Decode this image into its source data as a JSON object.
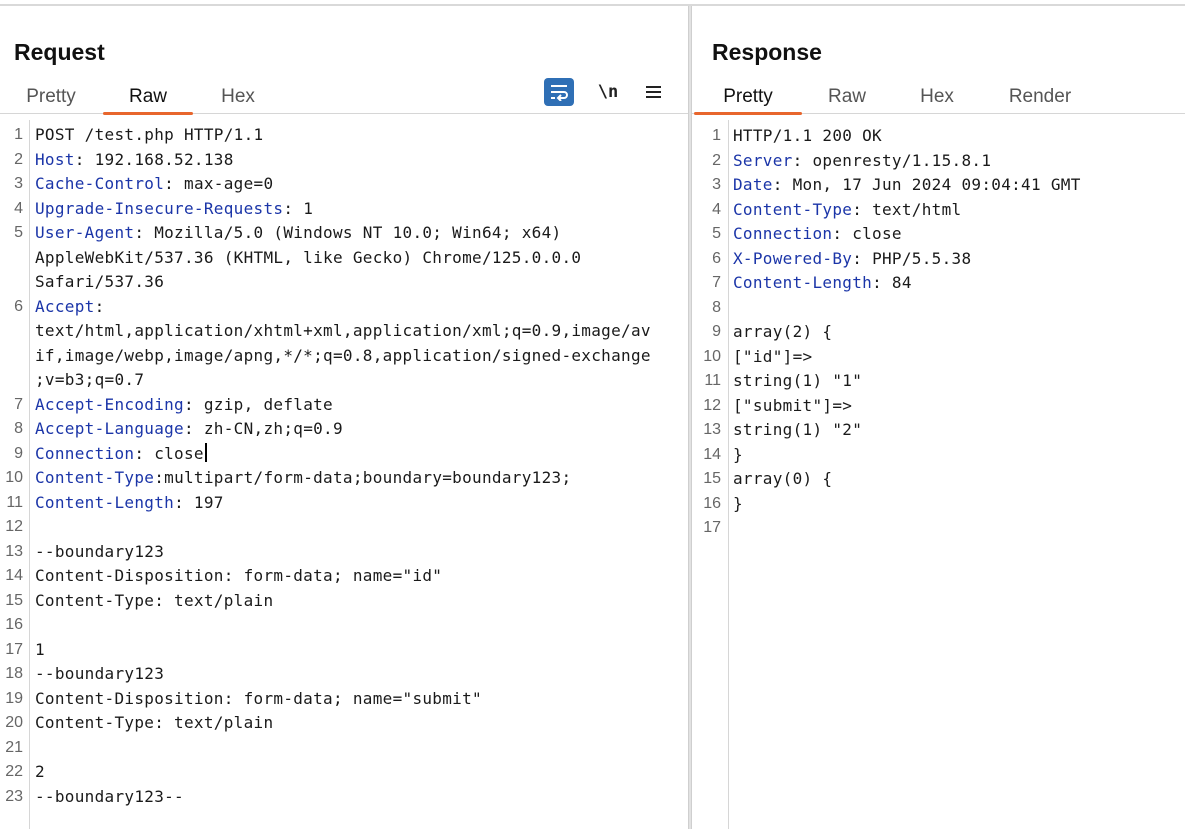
{
  "request": {
    "title": "Request",
    "tabs": [
      "Pretty",
      "Raw",
      "Hex"
    ],
    "active_tab": "Raw",
    "toolbar": {
      "newline_label": "\\n"
    },
    "lines": [
      {
        "n": "1",
        "key": "",
        "val": "POST /test.php HTTP/1.1"
      },
      {
        "n": "2",
        "key": "Host",
        "val": ": 192.168.52.138"
      },
      {
        "n": "3",
        "key": "Cache-Control",
        "val": ": max-age=0"
      },
      {
        "n": "4",
        "key": "Upgrade-Insecure-Requests",
        "val": ": 1"
      },
      {
        "n": "5",
        "key": "User-Agent",
        "val": ": Mozilla/5.0 (Windows NT 10.0; Win64; x64)"
      },
      {
        "n": "",
        "key": "",
        "val": "AppleWebKit/537.36 (KHTML, like Gecko) Chrome/125.0.0.0"
      },
      {
        "n": "",
        "key": "",
        "val": "Safari/537.36"
      },
      {
        "n": "6",
        "key": "Accept",
        "val": ":"
      },
      {
        "n": "",
        "key": "",
        "val": "text/html,application/xhtml+xml,application/xml;q=0.9,image/av"
      },
      {
        "n": "",
        "key": "",
        "val": "if,image/webp,image/apng,*/*;q=0.8,application/signed-exchange"
      },
      {
        "n": "",
        "key": "",
        "val": ";v=b3;q=0.7"
      },
      {
        "n": "7",
        "key": "Accept-Encoding",
        "val": ": gzip, deflate"
      },
      {
        "n": "8",
        "key": "Accept-Language",
        "val": ": zh-CN,zh;q=0.9"
      },
      {
        "n": "9",
        "key": "Connection",
        "val": ": close",
        "cursor": true,
        "highlight": true
      },
      {
        "n": "10",
        "key": "Content-Type",
        "val": ":multipart/form-data;boundary=boundary123;"
      },
      {
        "n": "11",
        "key": "Content-Length",
        "val": ": 197"
      },
      {
        "n": "12",
        "key": "",
        "val": ""
      },
      {
        "n": "13",
        "key": "",
        "val": "--boundary123"
      },
      {
        "n": "14",
        "key": "",
        "val": "Content-Disposition: form-data; name=\"id\""
      },
      {
        "n": "15",
        "key": "",
        "val": "Content-Type: text/plain"
      },
      {
        "n": "16",
        "key": "",
        "val": ""
      },
      {
        "n": "17",
        "key": "",
        "val": "1"
      },
      {
        "n": "18",
        "key": "",
        "val": "--boundary123"
      },
      {
        "n": "19",
        "key": "",
        "val": "Content-Disposition: form-data; name=\"submit\""
      },
      {
        "n": "20",
        "key": "",
        "val": "Content-Type: text/plain"
      },
      {
        "n": "21",
        "key": "",
        "val": ""
      },
      {
        "n": "22",
        "key": "",
        "val": "2"
      },
      {
        "n": "23",
        "key": "",
        "val": "--boundary123--"
      }
    ]
  },
  "response": {
    "title": "Response",
    "tabs": [
      "Pretty",
      "Raw",
      "Hex",
      "Render"
    ],
    "active_tab": "Pretty",
    "lines": [
      {
        "n": "1",
        "key": "",
        "val": "HTTP/1.1 200 OK",
        "highlight": true
      },
      {
        "n": "2",
        "key": "Server",
        "val": ": openresty/1.15.8.1"
      },
      {
        "n": "3",
        "key": "Date",
        "val": ": Mon, 17 Jun 2024 09:04:41 GMT"
      },
      {
        "n": "4",
        "key": "Content-Type",
        "val": ": text/html"
      },
      {
        "n": "5",
        "key": "Connection",
        "val": ": close"
      },
      {
        "n": "6",
        "key": "X-Powered-By",
        "val": ": PHP/5.5.38"
      },
      {
        "n": "7",
        "key": "Content-Length",
        "val": ": 84"
      },
      {
        "n": "8",
        "key": "",
        "val": ""
      },
      {
        "n": "9",
        "key": "",
        "val": "array(2) {"
      },
      {
        "n": "10",
        "key": "",
        "val": "[\"id\"]=>"
      },
      {
        "n": "11",
        "key": "",
        "val": "string(1) \"1\""
      },
      {
        "n": "12",
        "key": "",
        "val": "[\"submit\"]=>"
      },
      {
        "n": "13",
        "key": "",
        "val": "string(1) \"2\""
      },
      {
        "n": "14",
        "key": "",
        "val": "}"
      },
      {
        "n": "15",
        "key": "",
        "val": "array(0) {"
      },
      {
        "n": "16",
        "key": "",
        "val": "}"
      },
      {
        "n": "17",
        "key": "",
        "val": ""
      }
    ]
  },
  "colors": {
    "accent": "#e8662d",
    "header_key": "#1b35a8",
    "wrap_button": "#2f6fb5",
    "line_highlight": "#eeeeee"
  }
}
